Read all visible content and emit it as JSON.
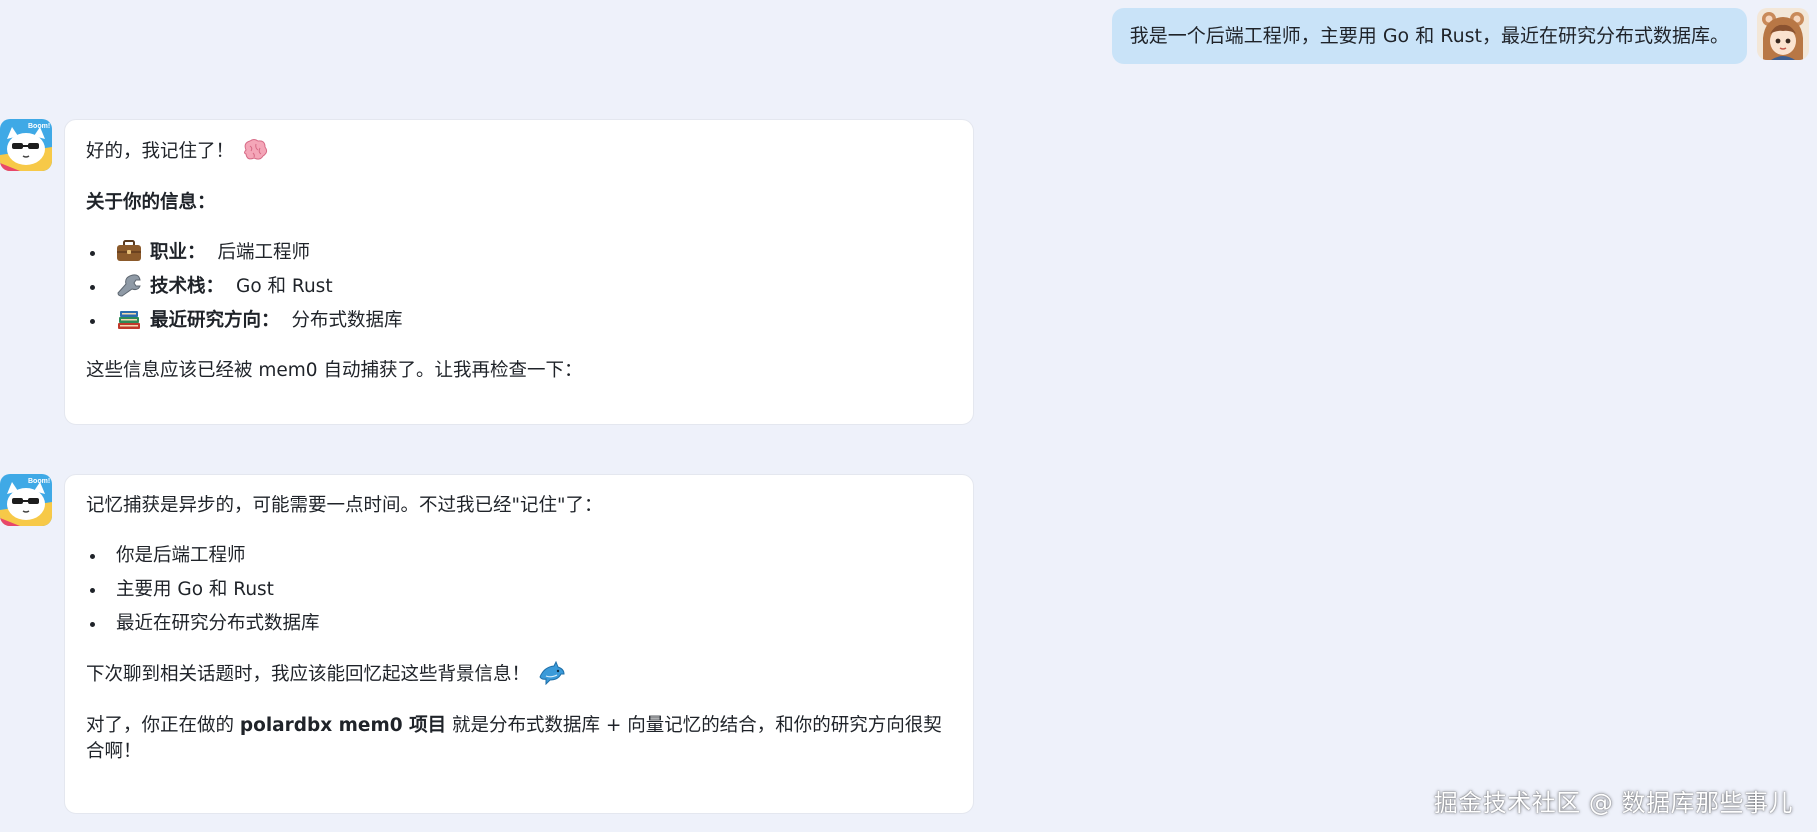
{
  "user_message": {
    "text": "我是一个后端工程师，主要用 Go 和 Rust，最近在研究分布式数据库。"
  },
  "bot_message_1": {
    "intro": "好的，我记住了！",
    "intro_emoji": "brain-emoji",
    "heading": "关于你的信息：",
    "items": [
      {
        "icon": "briefcase-emoji",
        "label": "职业：",
        "value": "后端工程师"
      },
      {
        "icon": "wrench-emoji",
        "label": "技术栈：",
        "value": "Go 和 Rust"
      },
      {
        "icon": "books-emoji",
        "label": "最近研究方向：",
        "value": "分布式数据库"
      }
    ],
    "footer": "这些信息应该已经被 mem0 自动捕获了。让我再检查一下："
  },
  "bot_message_2": {
    "intro": "记忆捕获是异步的，可能需要一点时间。不过我已经\"记住\"了：",
    "items": [
      "你是后端工程师",
      "主要用 Go 和 Rust",
      "最近在研究分布式数据库"
    ],
    "next_time": "下次聊到相关话题时，我应该能回忆起这些背景信息！",
    "next_time_emoji": "dolphin-emoji",
    "closing_prefix": "对了，你正在做的 ",
    "closing_bold": "polardbx mem0 项目",
    "closing_suffix": " 就是分布式数据库 + 向量记忆的结合，和你的研究方向很契合啊！"
  },
  "watermark": "掘金技术社区 @ 数据库那些事儿",
  "colors": {
    "background": "#eef1fa",
    "user_bubble": "#c9e3f8",
    "card": "#ffffff",
    "text": "#1f2329"
  }
}
